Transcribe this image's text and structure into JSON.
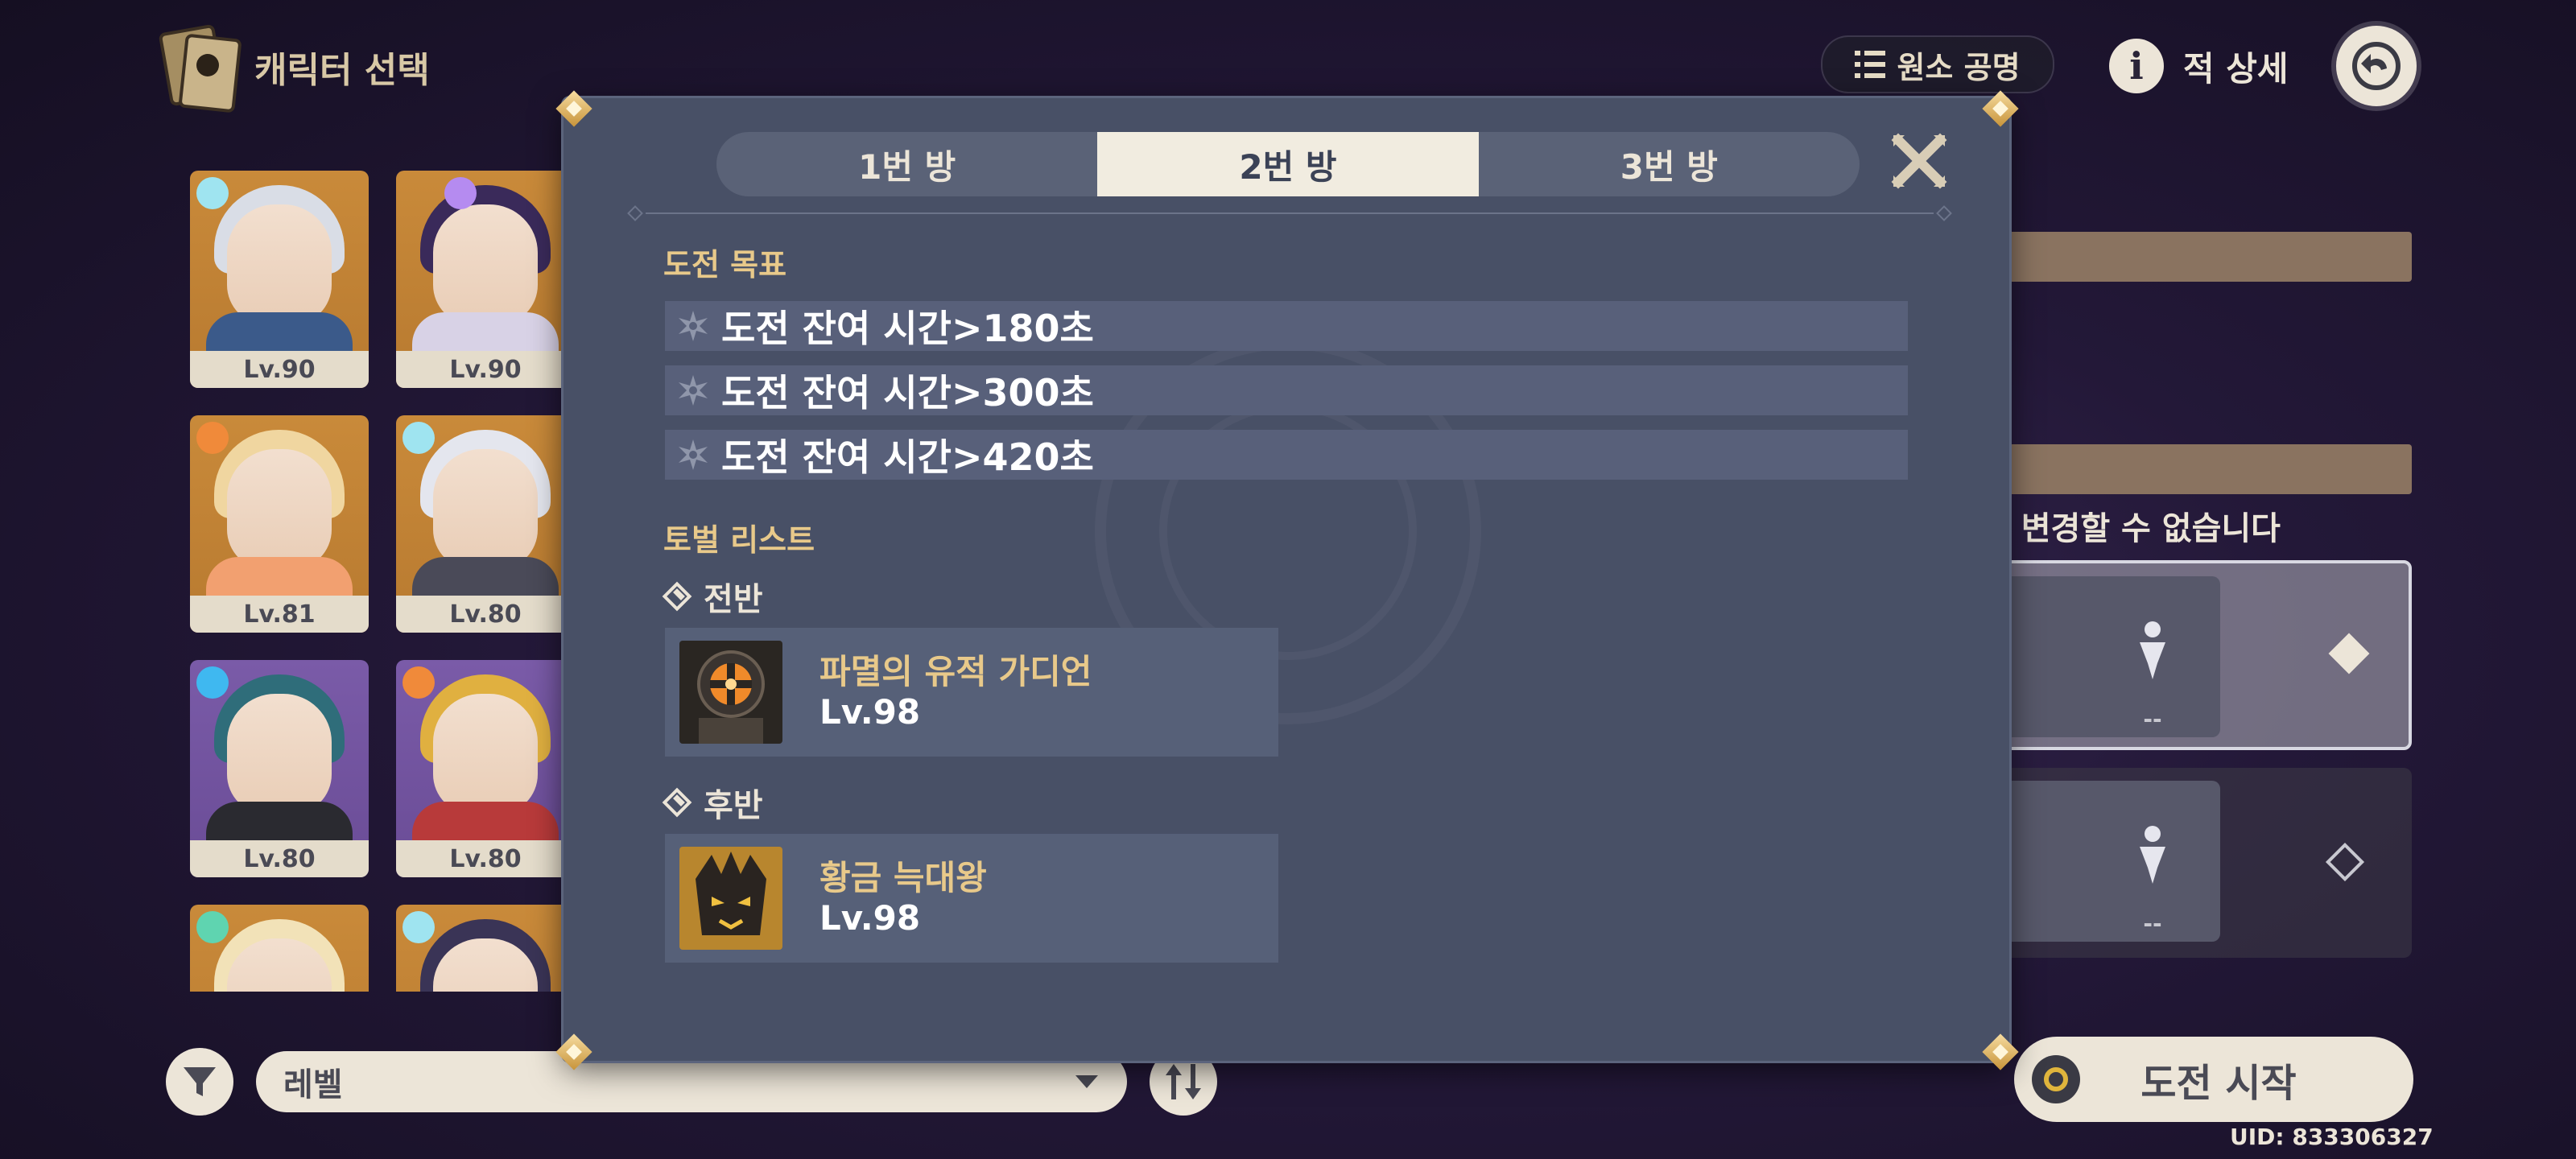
{
  "header": {
    "title": "캐릭터 선택",
    "resonance_label": "원소 공명",
    "enemy_details_label": "적 상세"
  },
  "characters": [
    {
      "level": "Lv.90",
      "element": "cryo",
      "bg": "gold"
    },
    {
      "level": "Lv.90",
      "element": "electro",
      "bg": "gold"
    },
    {
      "level": "Lv.81",
      "element": "pyro",
      "bg": "gold"
    },
    {
      "level": "Lv.80",
      "element": "cryo",
      "bg": "gold"
    },
    {
      "level": "Lv.80",
      "element": "hydro",
      "bg": "purple"
    },
    {
      "level": "Lv.80",
      "element": "pyro",
      "bg": "purple"
    },
    {
      "level": "",
      "element": "anemo",
      "bg": "gold"
    },
    {
      "level": "",
      "element": "cryo",
      "bg": "gold"
    }
  ],
  "bottom": {
    "sort_value": "레벨",
    "sort_direction_icon": "sort-toggle",
    "start_label": "도전 시작",
    "uid": "UID: 833306327"
  },
  "right_panel": {
    "warning_text": "중 변경할 수 없습니다",
    "team1_slots": [
      "--"
    ],
    "team2_slots": [
      "--"
    ]
  },
  "modal": {
    "tabs": [
      {
        "label": "1번 방",
        "active": false
      },
      {
        "label": "2번 방",
        "active": true
      },
      {
        "label": "3번 방",
        "active": false
      }
    ],
    "goals_title": "도전 목표",
    "goals": [
      "도전 잔여 시간>180초",
      "도전 잔여 시간>300초",
      "도전 잔여 시간>420초"
    ],
    "boss_list_title": "토벌 리스트",
    "first_half": {
      "label": "전반",
      "boss_name": "파멸의 유적 가디언",
      "boss_level": "Lv.98"
    },
    "second_half": {
      "label": "후반",
      "boss_name": "황금 늑대왕",
      "boss_level": "Lv.98"
    }
  },
  "colors": {
    "accent_gold": "#e8c98a",
    "modal_bg": "#485066",
    "tab_active_bg": "#f1ece0",
    "cryo": "#9fe4f0",
    "electro": "#b58bf0",
    "pyro": "#f08a3a",
    "hydro": "#3fb8f0",
    "anemo": "#5fd4b0"
  }
}
